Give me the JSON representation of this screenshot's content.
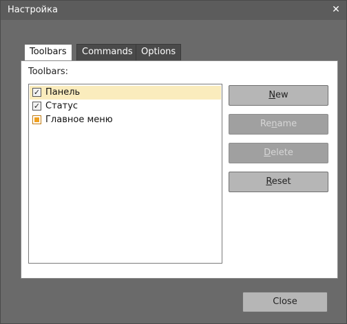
{
  "window": {
    "title": "Настройка"
  },
  "tabs": [
    {
      "label": "Toolbars",
      "active": true
    },
    {
      "label": "Commands",
      "active": false
    },
    {
      "label": "Options",
      "active": false
    }
  ],
  "toolbars_panel": {
    "label": "Toolbars:",
    "items": [
      {
        "label": "Панель",
        "state": "checked",
        "selected": true
      },
      {
        "label": "Статус",
        "state": "checked",
        "selected": false
      },
      {
        "label": "Главное меню",
        "state": "partial",
        "selected": false
      }
    ],
    "buttons": {
      "new": {
        "pre": "",
        "accel": "N",
        "post": "ew",
        "enabled": true
      },
      "rename": {
        "pre": "Re",
        "accel": "n",
        "post": "ame",
        "enabled": false
      },
      "delete": {
        "pre": "",
        "accel": "D",
        "post": "elete",
        "enabled": false
      },
      "reset": {
        "pre": "",
        "accel": "R",
        "post": "eset",
        "enabled": true
      }
    }
  },
  "footer": {
    "close_label": "Close"
  },
  "icons": {
    "check": "checkmark-icon",
    "close": "close-icon"
  },
  "colors": {
    "selection": "#faecbd",
    "titlebar": "#5c5c5c",
    "frame": "#6a6a6a"
  }
}
